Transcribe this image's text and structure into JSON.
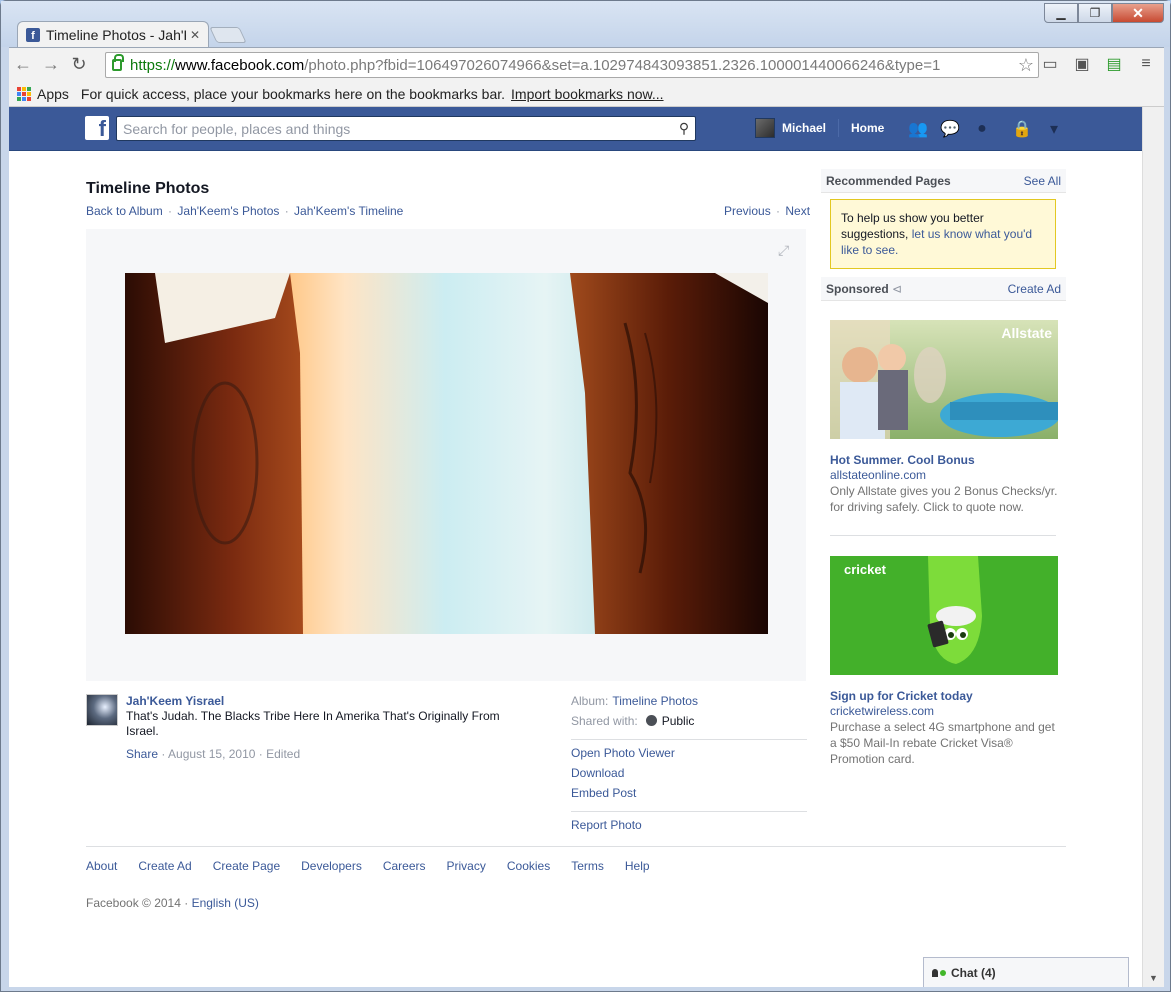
{
  "browser": {
    "tab_title": "Timeline Photos - Jah'Keem",
    "url_scheme": "https://",
    "url_host": "www.facebook.com",
    "url_path": "/photo.php?fbid=106497026074966&set=a.102974843093851.2326.100001440066246&type=1",
    "bookmarks_apps": "Apps",
    "bookmarks_hint": "For quick access, place your bookmarks here on the bookmarks bar.",
    "bookmarks_import": "Import bookmarks now..."
  },
  "fb_header": {
    "search_placeholder": "Search for people, places and things",
    "user_name": "Michael",
    "home_label": "Home"
  },
  "photo_page": {
    "title": "Timeline Photos",
    "crumbs": [
      "Back to Album",
      "Jah'Keem's Photos",
      "Jah'Keem's Timeline"
    ],
    "previous": "Previous",
    "next": "Next",
    "author": "Jah'Keem Yisrael",
    "caption": "That's Judah. The Blacks Tribe Here In Amerika That's Originally From Israel.",
    "share": "Share",
    "date": "August 15, 2010",
    "edited": "Edited",
    "album_label": "Album:",
    "album_name": "Timeline Photos",
    "shared_label": "Shared with:",
    "shared_value": "Public",
    "actions": [
      "Open Photo Viewer",
      "Download",
      "Embed Post"
    ],
    "report": "Report Photo"
  },
  "right_col": {
    "recommended": "Recommended Pages",
    "see_all": "See All",
    "notice_text": "To help us show you better suggestions,",
    "notice_link": "let us know what you'd like to see.",
    "sponsored": "Sponsored",
    "create_ad": "Create Ad",
    "ads": [
      {
        "brand": "Allstate",
        "title": "Hot Summer. Cool Bonus",
        "host": "allstateonline.com",
        "body": "Only Allstate gives you 2 Bonus Checks/yr. for driving safely. Click to quote now."
      },
      {
        "brand": "cricket",
        "title": "Sign up for Cricket today",
        "host": "cricketwireless.com",
        "body": "Purchase a select 4G smartphone and get a $50 Mail-In rebate Cricket Visa® Promotion card."
      }
    ]
  },
  "footer": {
    "links": [
      "About",
      "Create Ad",
      "Create Page",
      "Developers",
      "Careers",
      "Privacy",
      "Cookies",
      "Terms",
      "Help"
    ],
    "copyright": "Facebook © 2014 ·",
    "language": "English (US)"
  },
  "chat": {
    "label": "Chat (4)"
  },
  "colors": {
    "fb_blue": "#3b5998",
    "link": "#3b5998",
    "notice_bg": "#fff9d7",
    "cricket_green": "#43b02a"
  }
}
